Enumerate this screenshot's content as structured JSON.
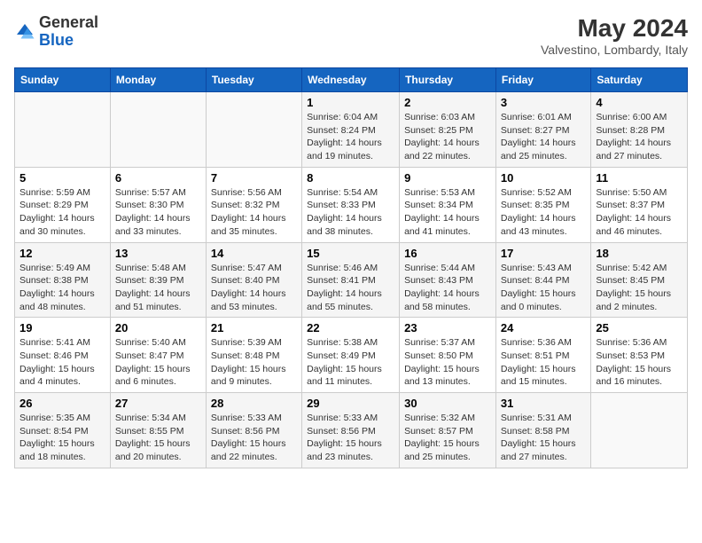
{
  "header": {
    "logo_general": "General",
    "logo_blue": "Blue",
    "month_year": "May 2024",
    "location": "Valvestino, Lombardy, Italy"
  },
  "days_of_week": [
    "Sunday",
    "Monday",
    "Tuesday",
    "Wednesday",
    "Thursday",
    "Friday",
    "Saturday"
  ],
  "weeks": [
    [
      {
        "day": "",
        "info": ""
      },
      {
        "day": "",
        "info": ""
      },
      {
        "day": "",
        "info": ""
      },
      {
        "day": "1",
        "info": "Sunrise: 6:04 AM\nSunset: 8:24 PM\nDaylight: 14 hours\nand 19 minutes."
      },
      {
        "day": "2",
        "info": "Sunrise: 6:03 AM\nSunset: 8:25 PM\nDaylight: 14 hours\nand 22 minutes."
      },
      {
        "day": "3",
        "info": "Sunrise: 6:01 AM\nSunset: 8:27 PM\nDaylight: 14 hours\nand 25 minutes."
      },
      {
        "day": "4",
        "info": "Sunrise: 6:00 AM\nSunset: 8:28 PM\nDaylight: 14 hours\nand 27 minutes."
      }
    ],
    [
      {
        "day": "5",
        "info": "Sunrise: 5:59 AM\nSunset: 8:29 PM\nDaylight: 14 hours\nand 30 minutes."
      },
      {
        "day": "6",
        "info": "Sunrise: 5:57 AM\nSunset: 8:30 PM\nDaylight: 14 hours\nand 33 minutes."
      },
      {
        "day": "7",
        "info": "Sunrise: 5:56 AM\nSunset: 8:32 PM\nDaylight: 14 hours\nand 35 minutes."
      },
      {
        "day": "8",
        "info": "Sunrise: 5:54 AM\nSunset: 8:33 PM\nDaylight: 14 hours\nand 38 minutes."
      },
      {
        "day": "9",
        "info": "Sunrise: 5:53 AM\nSunset: 8:34 PM\nDaylight: 14 hours\nand 41 minutes."
      },
      {
        "day": "10",
        "info": "Sunrise: 5:52 AM\nSunset: 8:35 PM\nDaylight: 14 hours\nand 43 minutes."
      },
      {
        "day": "11",
        "info": "Sunrise: 5:50 AM\nSunset: 8:37 PM\nDaylight: 14 hours\nand 46 minutes."
      }
    ],
    [
      {
        "day": "12",
        "info": "Sunrise: 5:49 AM\nSunset: 8:38 PM\nDaylight: 14 hours\nand 48 minutes."
      },
      {
        "day": "13",
        "info": "Sunrise: 5:48 AM\nSunset: 8:39 PM\nDaylight: 14 hours\nand 51 minutes."
      },
      {
        "day": "14",
        "info": "Sunrise: 5:47 AM\nSunset: 8:40 PM\nDaylight: 14 hours\nand 53 minutes."
      },
      {
        "day": "15",
        "info": "Sunrise: 5:46 AM\nSunset: 8:41 PM\nDaylight: 14 hours\nand 55 minutes."
      },
      {
        "day": "16",
        "info": "Sunrise: 5:44 AM\nSunset: 8:43 PM\nDaylight: 14 hours\nand 58 minutes."
      },
      {
        "day": "17",
        "info": "Sunrise: 5:43 AM\nSunset: 8:44 PM\nDaylight: 15 hours\nand 0 minutes."
      },
      {
        "day": "18",
        "info": "Sunrise: 5:42 AM\nSunset: 8:45 PM\nDaylight: 15 hours\nand 2 minutes."
      }
    ],
    [
      {
        "day": "19",
        "info": "Sunrise: 5:41 AM\nSunset: 8:46 PM\nDaylight: 15 hours\nand 4 minutes."
      },
      {
        "day": "20",
        "info": "Sunrise: 5:40 AM\nSunset: 8:47 PM\nDaylight: 15 hours\nand 6 minutes."
      },
      {
        "day": "21",
        "info": "Sunrise: 5:39 AM\nSunset: 8:48 PM\nDaylight: 15 hours\nand 9 minutes."
      },
      {
        "day": "22",
        "info": "Sunrise: 5:38 AM\nSunset: 8:49 PM\nDaylight: 15 hours\nand 11 minutes."
      },
      {
        "day": "23",
        "info": "Sunrise: 5:37 AM\nSunset: 8:50 PM\nDaylight: 15 hours\nand 13 minutes."
      },
      {
        "day": "24",
        "info": "Sunrise: 5:36 AM\nSunset: 8:51 PM\nDaylight: 15 hours\nand 15 minutes."
      },
      {
        "day": "25",
        "info": "Sunrise: 5:36 AM\nSunset: 8:53 PM\nDaylight: 15 hours\nand 16 minutes."
      }
    ],
    [
      {
        "day": "26",
        "info": "Sunrise: 5:35 AM\nSunset: 8:54 PM\nDaylight: 15 hours\nand 18 minutes."
      },
      {
        "day": "27",
        "info": "Sunrise: 5:34 AM\nSunset: 8:55 PM\nDaylight: 15 hours\nand 20 minutes."
      },
      {
        "day": "28",
        "info": "Sunrise: 5:33 AM\nSunset: 8:56 PM\nDaylight: 15 hours\nand 22 minutes."
      },
      {
        "day": "29",
        "info": "Sunrise: 5:33 AM\nSunset: 8:56 PM\nDaylight: 15 hours\nand 23 minutes."
      },
      {
        "day": "30",
        "info": "Sunrise: 5:32 AM\nSunset: 8:57 PM\nDaylight: 15 hours\nand 25 minutes."
      },
      {
        "day": "31",
        "info": "Sunrise: 5:31 AM\nSunset: 8:58 PM\nDaylight: 15 hours\nand 27 minutes."
      },
      {
        "day": "",
        "info": ""
      }
    ]
  ]
}
